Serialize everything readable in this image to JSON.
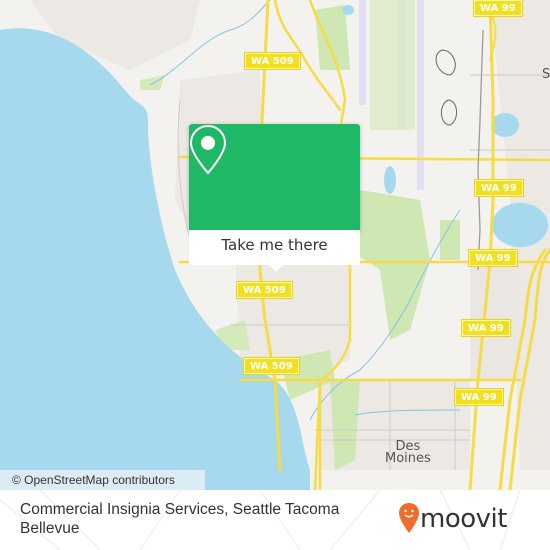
{
  "map": {
    "colors": {
      "water": "#a7d9ee",
      "land": "#f3f2ef",
      "urban": "#ece8e4",
      "park": "#cfe7b3",
      "highway": "#f5dc46",
      "runway": "#e6dff3",
      "minor_road": "#cfcac6",
      "stream": "#84c4e4"
    },
    "shields": [
      {
        "id": "wa509-north",
        "label": "WA 509"
      },
      {
        "id": "wa509-mid",
        "label": "WA 509"
      },
      {
        "id": "wa509-south",
        "label": "WA 509"
      },
      {
        "id": "wa99-top",
        "label": "WA 99"
      },
      {
        "id": "wa99-1",
        "label": "WA 99"
      },
      {
        "id": "wa99-2",
        "label": "WA 99"
      },
      {
        "id": "wa99-3",
        "label": "WA 99"
      },
      {
        "id": "wa99-4",
        "label": "WA 99"
      }
    ],
    "place_labels": {
      "des_moines": "Des\nMoines",
      "seatac_partial": "S"
    },
    "attribution": "© OpenStreetMap contributors"
  },
  "popup": {
    "icon": "map-pin-icon",
    "button_label": "Take me there",
    "accent_color": "#1fb866"
  },
  "footer": {
    "title": "Commercial Insignia Services, Seattle Tacoma Bellevue",
    "logo_text": "moovit",
    "logo_icon": "moovit-pin-icon",
    "logo_color": "#f26b2a"
  }
}
